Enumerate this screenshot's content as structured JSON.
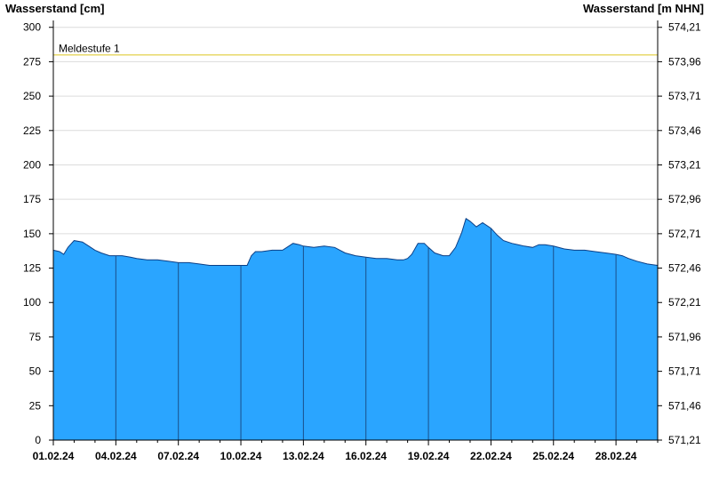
{
  "chart_data": {
    "type": "area",
    "ylabel_left": "Wasserstand [cm]",
    "ylabel_right": "Wasserstand [m NHN]",
    "ylim": [
      0,
      305
    ],
    "yticks_left": [
      0,
      25,
      50,
      75,
      100,
      125,
      150,
      175,
      200,
      225,
      250,
      275,
      300
    ],
    "yticks_right": [
      "571,21",
      "571,46",
      "571,71",
      "571,96",
      "572,21",
      "572,46",
      "572,71",
      "572,96",
      "573,21",
      "573,46",
      "573,71",
      "573,96",
      "574,21"
    ],
    "xlim": [
      "01.02.24 00:00",
      "29.02.24 23:59"
    ],
    "xtick_labels": [
      "01.02.24",
      "04.02.24",
      "07.02.24",
      "10.02.24",
      "13.02.24",
      "16.02.24",
      "19.02.24",
      "22.02.24",
      "25.02.24",
      "28.02.24"
    ],
    "grid": true,
    "threshold": {
      "label": "Meldestufe 1",
      "value": 280,
      "color": "#e8d96a"
    },
    "series": [
      {
        "color": "#2aa5ff",
        "x_days": [
          0,
          0.3,
          0.5,
          0.7,
          1.0,
          1.4,
          1.7,
          2.0,
          2.3,
          2.7,
          3.0,
          3.3,
          3.7,
          4.0,
          4.5,
          5.0,
          5.5,
          6.0,
          6.5,
          7.0,
          7.5,
          8.0,
          8.5,
          9.0,
          9.3,
          9.5,
          9.7,
          10.0,
          10.5,
          11.0,
          11.3,
          11.5,
          11.8,
          12.0,
          12.5,
          13.0,
          13.5,
          14.0,
          14.5,
          15.0,
          15.5,
          16.0,
          16.5,
          16.8,
          17.0,
          17.2,
          17.5,
          17.8,
          18.0,
          18.3,
          18.7,
          19.0,
          19.3,
          19.6,
          19.8,
          20.0,
          20.3,
          20.6,
          21.0,
          21.3,
          21.6,
          22.0,
          22.3,
          22.6,
          23.0,
          23.3,
          23.6,
          24.0,
          24.5,
          25.0,
          25.5,
          26.0,
          26.5,
          27.0,
          27.3,
          27.6,
          28.0,
          28.5,
          29.0
        ],
        "values": [
          138,
          137,
          135,
          140,
          145,
          144,
          141,
          138,
          136,
          134,
          134,
          134,
          133,
          132,
          131,
          131,
          130,
          129,
          129,
          128,
          127,
          127,
          127,
          127,
          127,
          134,
          137,
          137,
          138,
          138,
          141,
          143,
          142,
          141,
          140,
          141,
          140,
          136,
          134,
          133,
          132,
          132,
          131,
          131,
          132,
          135,
          143,
          143,
          140,
          136,
          134,
          134,
          140,
          151,
          161,
          159,
          155,
          158,
          154,
          149,
          145,
          143,
          142,
          141,
          140,
          142,
          142,
          141,
          139,
          138,
          138,
          137,
          136,
          135,
          134,
          132,
          130,
          128,
          127
        ]
      }
    ]
  }
}
